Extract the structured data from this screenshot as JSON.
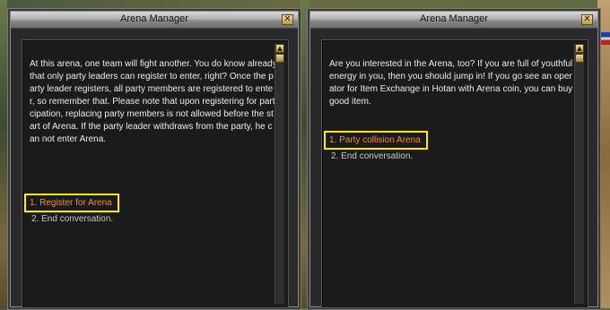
{
  "left_window": {
    "title": "Arena Manager",
    "close_label": "✕",
    "body": "At this arena, one team will fight another.  You do know already that only party leaders can register to enter, right?  Once the party leader registers, all party members are registered to enter, so remember that. Please note that upon registering for participation,  replacing party members is not allowed before the start of Arena. If the party leader withdraws from the party, he can not enter Arena.",
    "options": [
      "1. Register for Arena",
      "2. End conversation."
    ]
  },
  "right_window": {
    "title": "Arena Manager",
    "close_label": "✕",
    "body": "Are you interested in the Arena, too?  If you are full of youthful energy in you, then you should jump in! If you go see an operator for Item Exchange in Hotan with Arena coin, you can buy good item.",
    "options": [
      "1. Party collision Arena",
      "2. End conversation."
    ]
  },
  "colors": {
    "highlight": "#ffea00",
    "option_primary": "#f08f3c",
    "option_secondary": "#c8c8c8",
    "text": "#ececec"
  },
  "icons": {
    "close": "close-icon",
    "scroll_up": "scroll-up-icon",
    "scroll_thumb": "scroll-thumb"
  }
}
